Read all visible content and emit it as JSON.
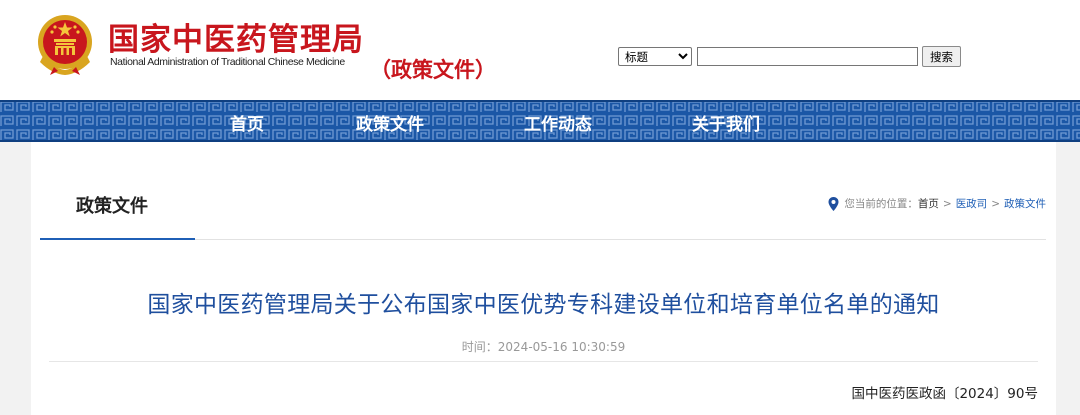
{
  "header": {
    "site_name_cn": "国家中医药管理局",
    "site_name_en": "National Administration of Traditional Chinese Medicine",
    "section_tag": "（政策文件）"
  },
  "search": {
    "field_selected": "标题",
    "field_options": [
      "标题"
    ],
    "query": "",
    "button_label": "搜索"
  },
  "nav": {
    "items": [
      {
        "label": "首页"
      },
      {
        "label": "政策文件"
      },
      {
        "label": "工作动态"
      },
      {
        "label": "关于我们"
      }
    ]
  },
  "panel": {
    "title": "政策文件",
    "breadcrumb": {
      "prefix": "您当前的位置：",
      "items": [
        "首页",
        "医政司",
        "政策文件"
      ],
      "separator": ">"
    }
  },
  "article": {
    "title": "国家中医药管理局关于公布国家中医优势专科建设单位和培育单位名单的通知",
    "time_label": "时间：",
    "time_value": "2024-05-16 10:30:59",
    "doc_number": "国中医药医政函〔2024〕90号"
  },
  "colors": {
    "brand_red": "#c8161d",
    "nav_blue": "#1b57a6",
    "title_blue": "#1f4f9e",
    "link_blue": "#1f5fb6"
  },
  "icons": {
    "emblem": "national-emblem",
    "location": "map-pin-icon"
  }
}
